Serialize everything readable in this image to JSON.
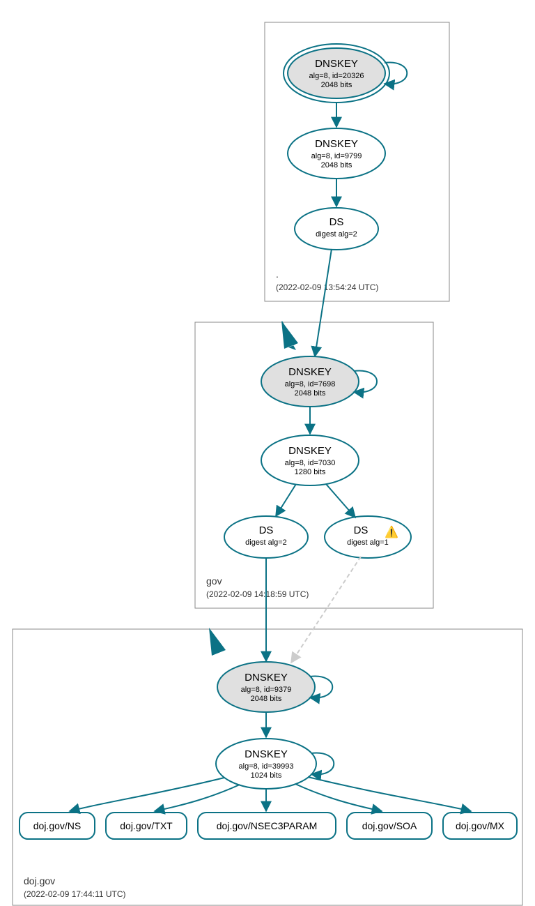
{
  "zones": {
    "root": {
      "label": ".",
      "timestamp": "(2022-02-09 13:54:24 UTC)",
      "ksk": {
        "title": "DNSKEY",
        "line1": "alg=8, id=20326",
        "line2": "2048 bits"
      },
      "zsk": {
        "title": "DNSKEY",
        "line1": "alg=8, id=9799",
        "line2": "2048 bits"
      },
      "ds": {
        "title": "DS",
        "line1": "digest alg=2"
      }
    },
    "gov": {
      "label": "gov",
      "timestamp": "(2022-02-09 14:18:59 UTC)",
      "ksk": {
        "title": "DNSKEY",
        "line1": "alg=8, id=7698",
        "line2": "2048 bits"
      },
      "zsk": {
        "title": "DNSKEY",
        "line1": "alg=8, id=7030",
        "line2": "1280 bits"
      },
      "ds_a": {
        "title": "DS",
        "line1": "digest alg=2"
      },
      "ds_b": {
        "title": "DS",
        "line1": "digest alg=1",
        "warn": "⚠️"
      }
    },
    "doj": {
      "label": "doj.gov",
      "timestamp": "(2022-02-09 17:44:11 UTC)",
      "ksk": {
        "title": "DNSKEY",
        "line1": "alg=8, id=9379",
        "line2": "2048 bits"
      },
      "zsk": {
        "title": "DNSKEY",
        "line1": "alg=8, id=39993",
        "line2": "1024 bits"
      },
      "leaves": {
        "ns": "doj.gov/NS",
        "txt": "doj.gov/TXT",
        "nsec3": "doj.gov/NSEC3PARAM",
        "soa": "doj.gov/SOA",
        "mx": "doj.gov/MX"
      }
    }
  }
}
